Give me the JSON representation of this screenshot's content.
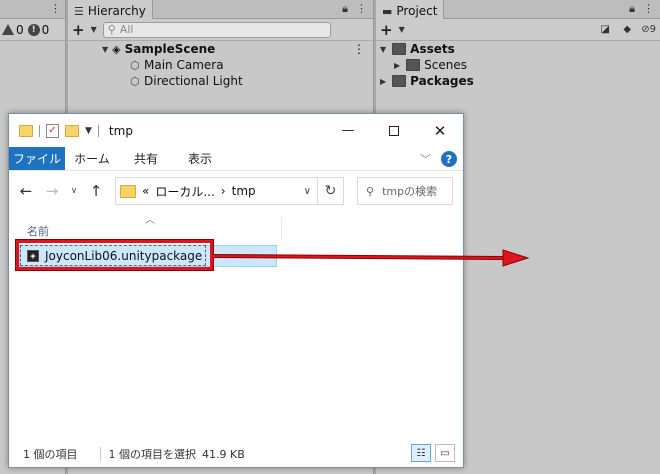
{
  "unity": {
    "console": {
      "warn_count": "0",
      "error_count": "0"
    },
    "hierarchy": {
      "tab_label": "Hierarchy",
      "search_placeholder": "All",
      "scene_name": "SampleScene",
      "objects": [
        "Main Camera",
        "Directional Light"
      ]
    },
    "project": {
      "tab_label": "Project",
      "hidden_count": "9",
      "tree": [
        {
          "label": "Assets",
          "expanded": true
        },
        {
          "label": "Scenes",
          "child": true
        },
        {
          "label": "Packages",
          "expanded": false
        }
      ]
    }
  },
  "explorer": {
    "title": "tmp",
    "ribbon_tabs": [
      "ファイル",
      "ホーム",
      "共有",
      "表示"
    ],
    "help_label": "?",
    "address": {
      "prefix": "«",
      "crumbs": [
        "ローカル...",
        "tmp"
      ],
      "separator": "›"
    },
    "search_placeholder": "tmpの検索",
    "column_name": "名前",
    "selected_file": "JoyconLib06.unitypackage",
    "status": {
      "item_count": "1 個の項目",
      "selection": "1 個の項目を選択",
      "size": "41.9 KB"
    }
  },
  "annotation": {
    "arrow_color": "#e0141e",
    "box_color": "#e0141e"
  },
  "colors": {
    "accent": "#1e73be",
    "selection": "#cce8ff"
  }
}
